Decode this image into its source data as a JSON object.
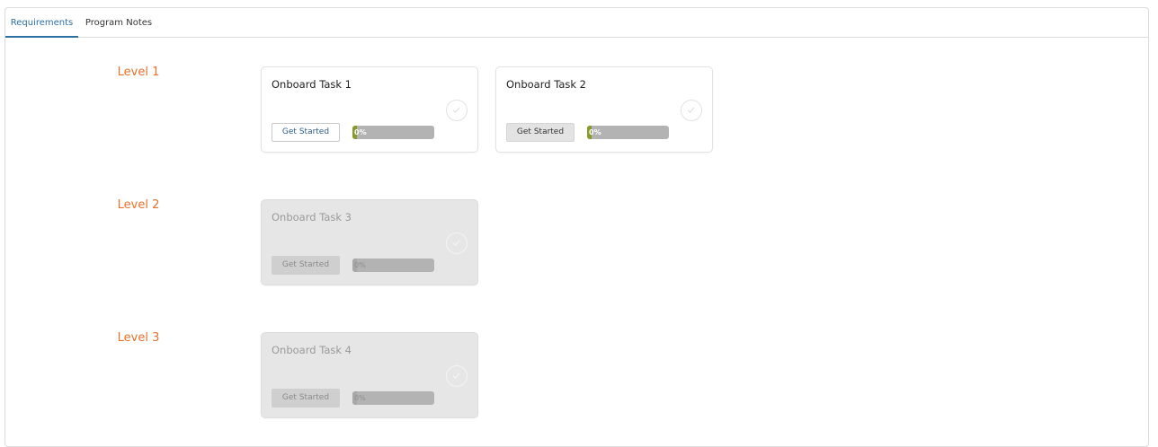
{
  "tabs": [
    {
      "label": "Requirements",
      "active": true
    },
    {
      "label": "Program Notes",
      "active": false
    }
  ],
  "levels": [
    {
      "label": "Level 1"
    },
    {
      "label": "Level 2"
    },
    {
      "label": "Level 3"
    }
  ],
  "tasks": [
    {
      "title": "Onboard Task 1",
      "button": "Get Started",
      "progress_label": "0%",
      "progress": 0,
      "enabled": true
    },
    {
      "title": "Onboard Task 2",
      "button": "Get Started",
      "progress_label": "0%",
      "progress": 0,
      "enabled": true
    },
    {
      "title": "Onboard Task 3",
      "button": "Get Started",
      "progress_label": "0%",
      "progress": 0,
      "enabled": false
    },
    {
      "title": "Onboard Task 4",
      "button": "Get Started",
      "progress_label": "0%",
      "progress": 0,
      "enabled": false
    }
  ],
  "colors": {
    "accent": "#2c6fa3",
    "level_label": "#e8722e",
    "progress_fill": "#8a9a2a",
    "progress_track": "#b3b3b3"
  },
  "icons": {
    "task_status": "check-circle-icon"
  }
}
